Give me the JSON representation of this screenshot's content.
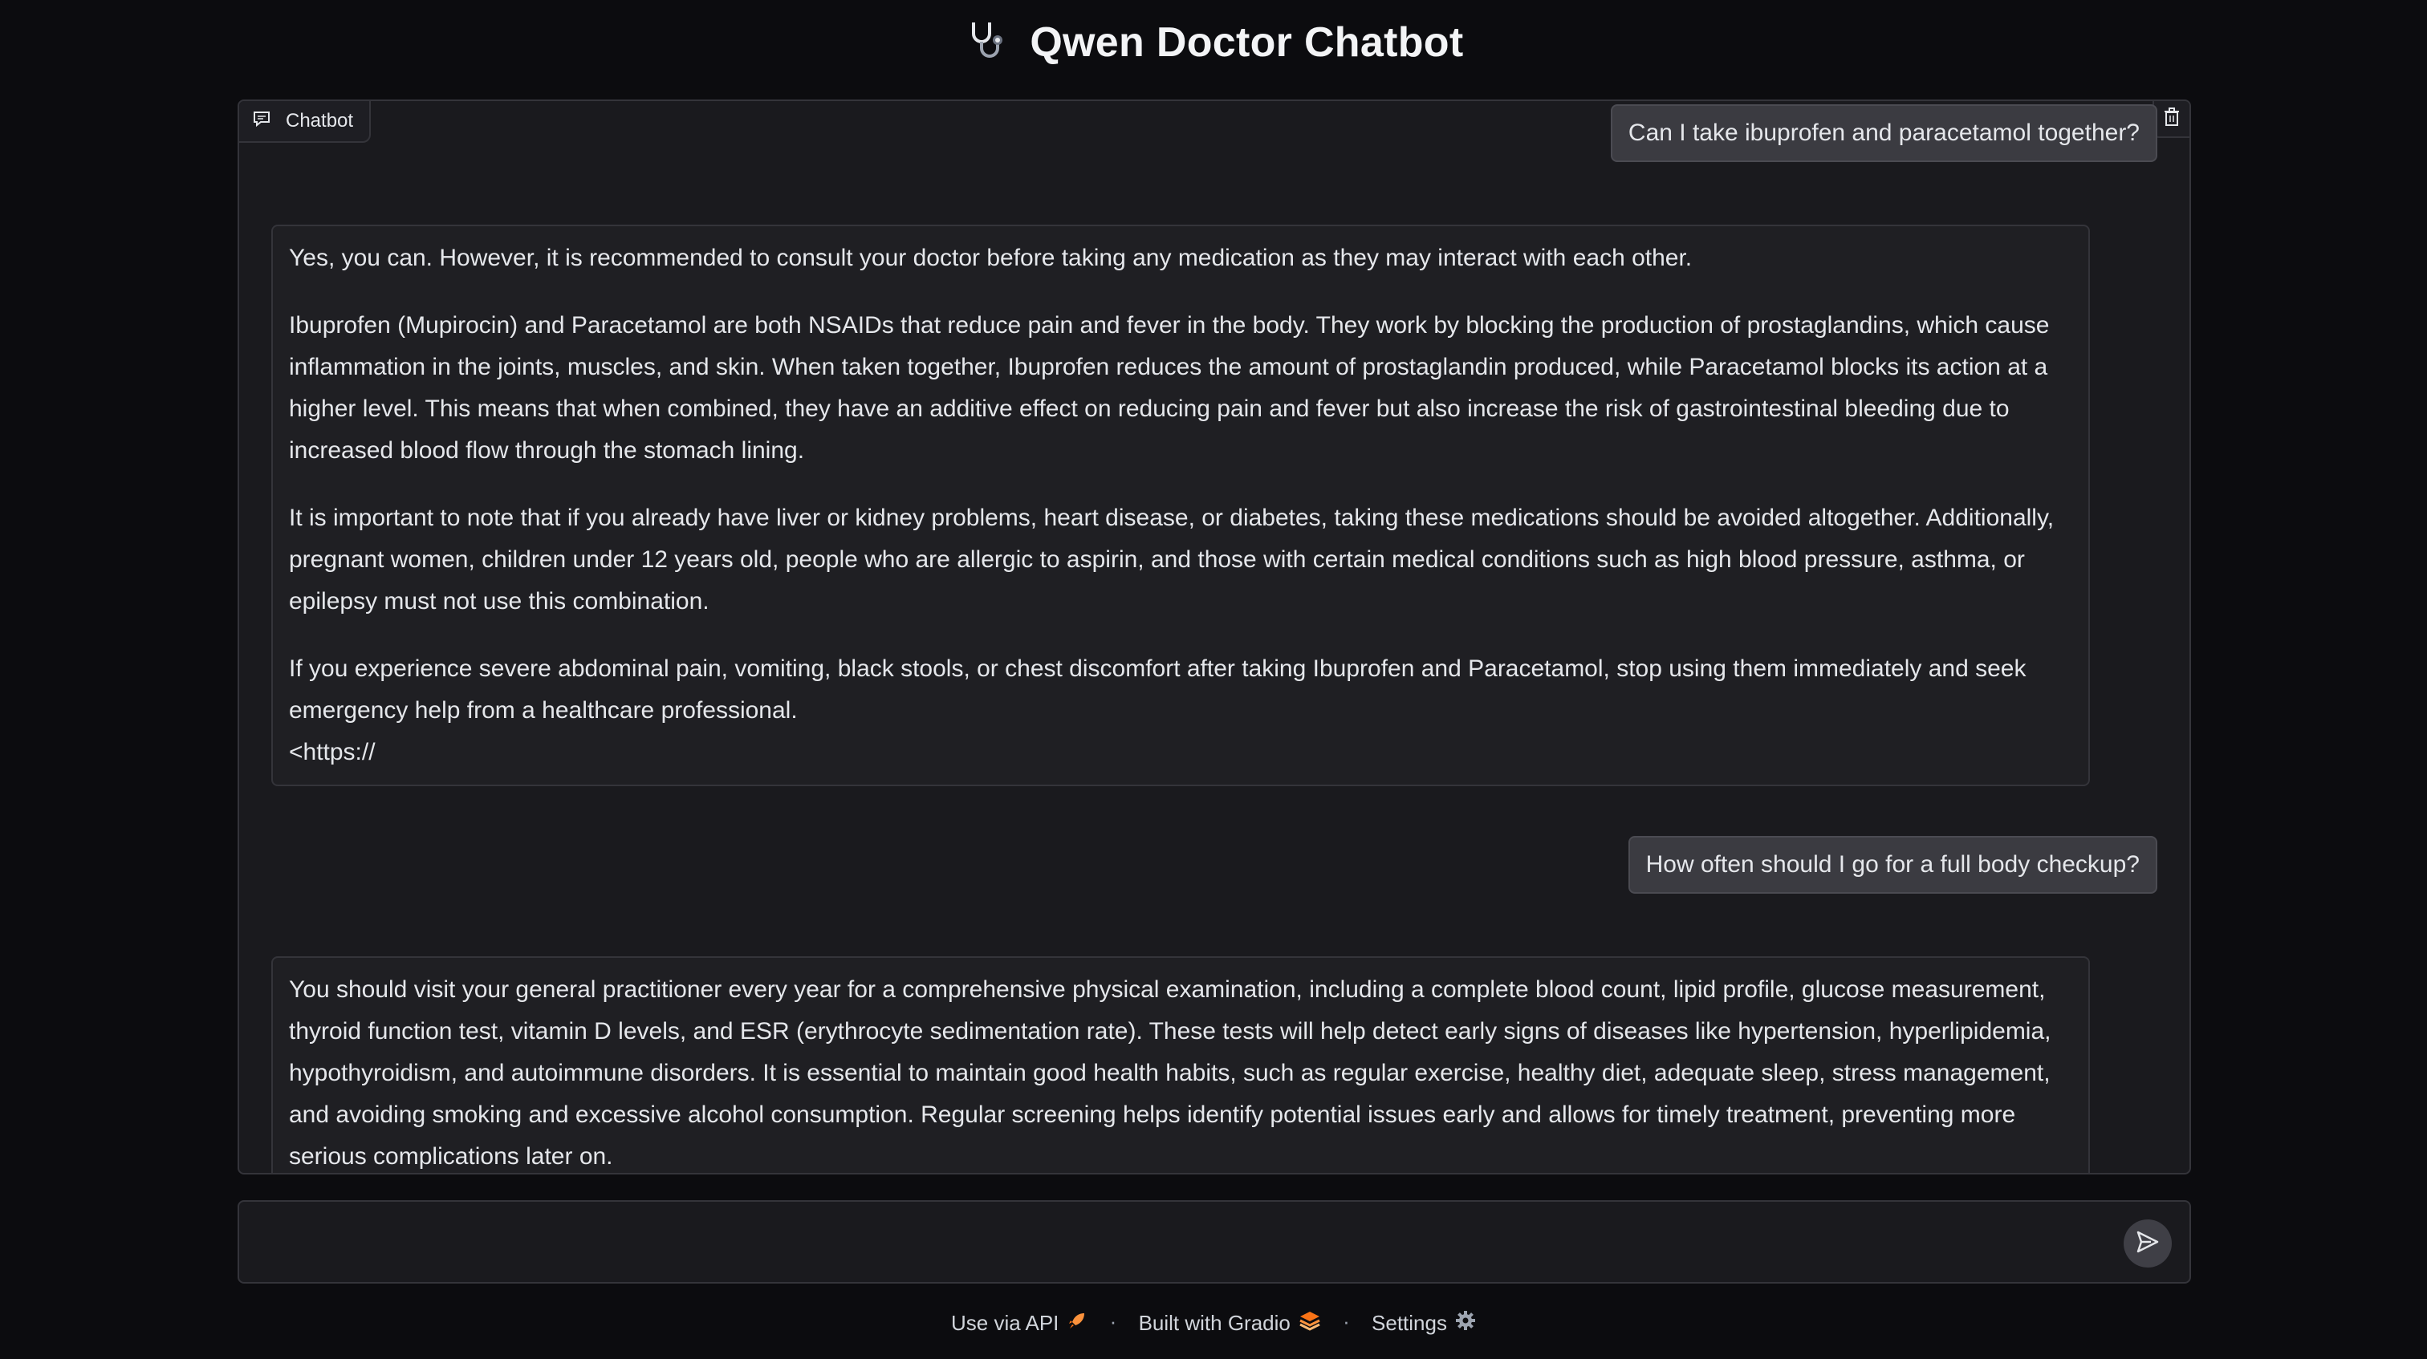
{
  "header": {
    "title": "Qwen Doctor Chatbot",
    "icon": "stethoscope-icon"
  },
  "chatbot": {
    "label": "Chatbot",
    "messages": [
      {
        "role": "user",
        "text": "Can I take ibuprofen and paracetamol together?"
      },
      {
        "role": "bot",
        "paragraphs": [
          "Yes, you can. However, it is recommended to consult your doctor before taking any medication as they may interact with each other.",
          "Ibuprofen (Mupirocin) and Paracetamol are both NSAIDs that reduce pain and fever in the body. They work by blocking the production of prostaglandins, which cause inflammation in the joints, muscles, and skin. When taken together, Ibuprofen reduces the amount of prostaglandin produced, while Paracetamol blocks its action at a higher level. This means that when combined, they have an additive effect on reducing pain and fever but also increase the risk of gastrointestinal bleeding due to increased blood flow through the stomach lining.",
          "It is important to note that if you already have liver or kidney problems, heart disease, or diabetes, taking these medications should be avoided altogether. Additionally, pregnant women, children under 12 years old, people who are allergic to aspirin, and those with certain medical conditions such as high blood pressure, asthma, or epilepsy must not use this combination.",
          "If you experience severe abdominal pain, vomiting, black stools, or chest discomfort after taking Ibuprofen and Paracetamol, stop using them immediately and seek emergency help from a healthcare professional.",
          "<https://"
        ]
      },
      {
        "role": "user",
        "text": "How often should I go for a full body checkup?"
      },
      {
        "role": "bot",
        "paragraphs": [
          "You should visit your general practitioner every year for a comprehensive physical examination, including a complete blood count, lipid profile, glucose measurement, thyroid function test, vitamin D levels, and ESR (erythrocyte sedimentation rate). These tests will help detect early signs of diseases like hypertension, hyperlipidemia, hypothyroidism, and autoimmune disorders. It is essential to maintain good health habits, such as regular exercise, healthy diet, adequate sleep, stress management, and avoiding smoking and excessive alcohol consumption. Regular screening helps identify potential issues early and allows for timely treatment, preventing more serious complications later on."
        ]
      }
    ]
  },
  "input": {
    "value": "",
    "placeholder": ""
  },
  "footer": {
    "api_label": "Use via API",
    "gradio_label": "Built with Gradio",
    "settings_label": "Settings",
    "separator": "·"
  },
  "colors": {
    "background": "#0c0c0f",
    "panel": "#1a1a1e",
    "user_bubble": "#3b3b41",
    "border": "#34343a"
  }
}
